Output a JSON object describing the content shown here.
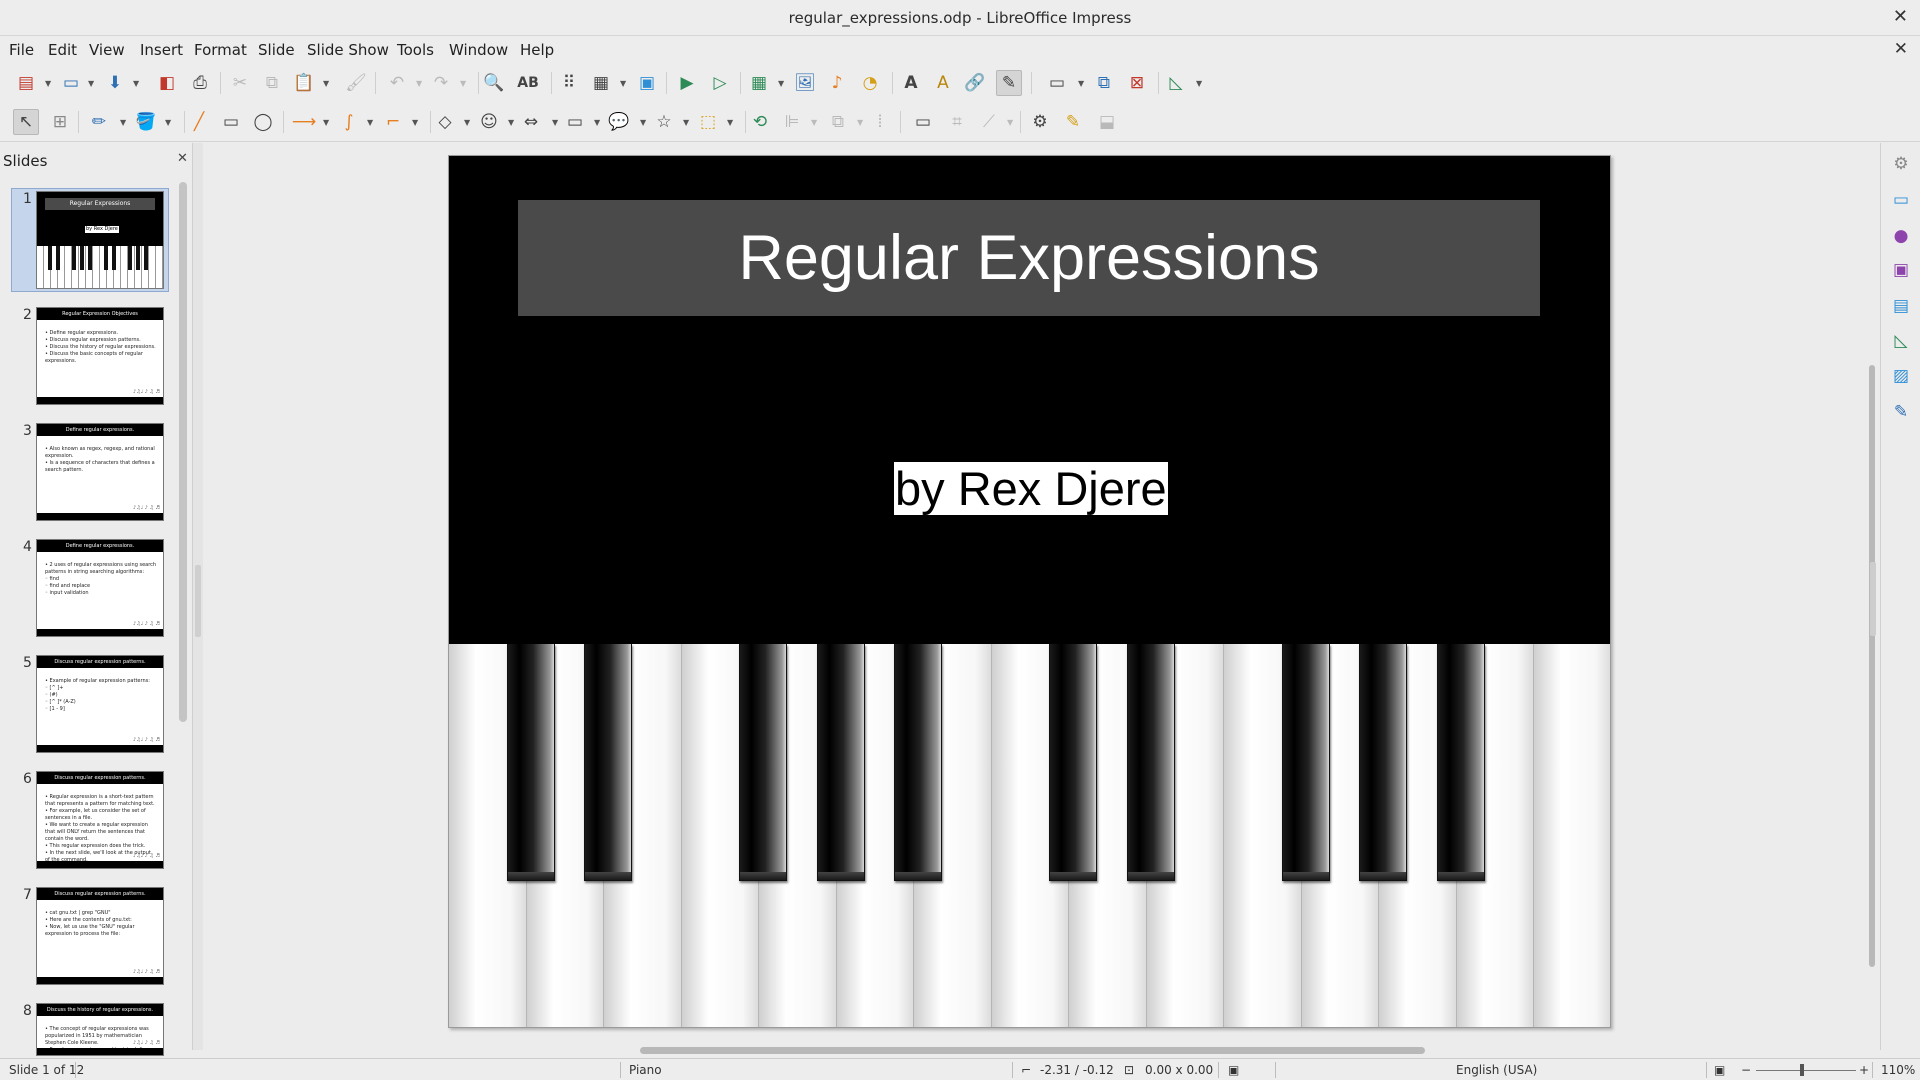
{
  "window": {
    "title": "regular_expressions.odp - LibreOffice Impress",
    "close_glyph": "✕"
  },
  "menu": {
    "items": [
      "File",
      "Edit",
      "View",
      "Insert",
      "Format",
      "Slide",
      "Slide Show",
      "Tools",
      "Window",
      "Help"
    ],
    "doc_close_glyph": "✕"
  },
  "slide_panel": {
    "title": "Slides",
    "close_glyph": "✕",
    "thumbnails": [
      {
        "number": "1",
        "title": "Regular Expressions",
        "subtitle": "by Rex Djere",
        "lines": []
      },
      {
        "number": "2",
        "title": "Regular Expression Objectives",
        "lines": [
          "• Define regular expressions.",
          "• Discuss regular expression patterns.",
          "• Discuss the history of regular expressions.",
          "• Discuss the basic concepts of regular expressions."
        ]
      },
      {
        "number": "3",
        "title": "Define regular expressions.",
        "lines": [
          "• Also known as regex, regexp, and rational expression.",
          "• Is a sequence of characters that defines a search pattern."
        ]
      },
      {
        "number": "4",
        "title": "Define regular expressions.",
        "lines": [
          "• 2 uses of regular expressions using search patterns in string searching algorithms:",
          "   ◦ find",
          "   ◦ find and replace",
          "   ◦ input validation"
        ]
      },
      {
        "number": "5",
        "title": "Discuss regular expression patterns.",
        "lines": [
          "• Example of regular expression patterns:",
          "   ◦ [^ ]+",
          "   ◦ (#)",
          "   ◦ [^ ]* (A-Z)",
          "   ◦ [1 - 9]"
        ]
      },
      {
        "number": "6",
        "title": "Discuss regular expression patterns.",
        "lines": [
          "• Regular expression is a short-text pattern that represents a pattern for matching text.",
          "• For example, let us consider the set of sentences in a file.",
          "• We want to create a regular expression that will ONLY return the sentences that contain the word.",
          "• This regular expression does the trick.",
          "• In the next slide, we'll look at the output of the command."
        ]
      },
      {
        "number": "7",
        "title": "Discuss regular expression patterns.",
        "lines": [
          "• cat gnu.txt | grep \"GNU\"",
          "• Here are the contents of gnu.txt:",
          "",
          "• Now, let us use the \"GNU\" regular expression to process the file:"
        ]
      },
      {
        "number": "8",
        "title": "Discuss the history of regular expressions.",
        "lines": [
          "• The concept of regular expressions was popularized in 1951 by mathematician Stephen Cole Kleene.",
          "• Regular expressions used text to define text"
        ]
      }
    ]
  },
  "slide": {
    "title": "Regular Expressions",
    "subtitle": "by Rex Djere",
    "background": "#000000",
    "title_box_color": "#4a4a4a"
  },
  "status": {
    "slide_info": "Slide 1 of 12",
    "master": "Piano",
    "position": "-2.31 / -0.12",
    "size": "0.00 x 0.00",
    "language": "English (USA)",
    "zoom": "110%",
    "zoom_minus": "−",
    "zoom_plus": "+"
  },
  "toolbar1_icons": [
    "new-icon",
    "open-icon",
    "save-icon",
    "export-pdf-icon",
    "print-icon",
    "cut-icon",
    "copy-icon",
    "paste-icon",
    "clone-formatting-icon",
    "undo-icon",
    "redo-icon",
    "find-replace-icon",
    "spelling-icon",
    "grid-icon",
    "display-views-icon",
    "master-slide-icon",
    "start-first-slide-icon",
    "start-current-slide-icon",
    "table-icon",
    "image-icon",
    "media-icon",
    "chart-icon",
    "text-box-icon",
    "fontwork-icon",
    "hyperlink-icon",
    "draw-function-icon",
    "slide-layout-icon",
    "new-slide-icon",
    "delete-slide-icon",
    "display-grid-icon"
  ],
  "toolbar2_icons": [
    "select-icon",
    "zoom-pan-icon",
    "line-color-icon",
    "fill-color-icon",
    "line-icon",
    "rectangle-icon",
    "ellipse-icon",
    "arrow-line-icon",
    "curve-icon",
    "connector-icon",
    "basic-shapes-icon",
    "symbol-shapes-icon",
    "block-arrows-icon",
    "flowchart-icon",
    "callouts-icon",
    "stars-icon",
    "3d-objects-icon",
    "rotate-icon",
    "align-icon",
    "arrange-icon",
    "distribute-icon",
    "shadow-icon",
    "crop-icon",
    "filter-icon",
    "toggle-extrusion-icon",
    "glue-points-icon",
    "show-gluepoints-icon",
    "bezier-icon"
  ],
  "sidebar_icons": [
    "properties-icon",
    "slide-transition-icon",
    "animation-icon",
    "master-slides-icon",
    "styles-icon",
    "gallery-icon",
    "navigator-icon",
    "shapes-icon"
  ]
}
